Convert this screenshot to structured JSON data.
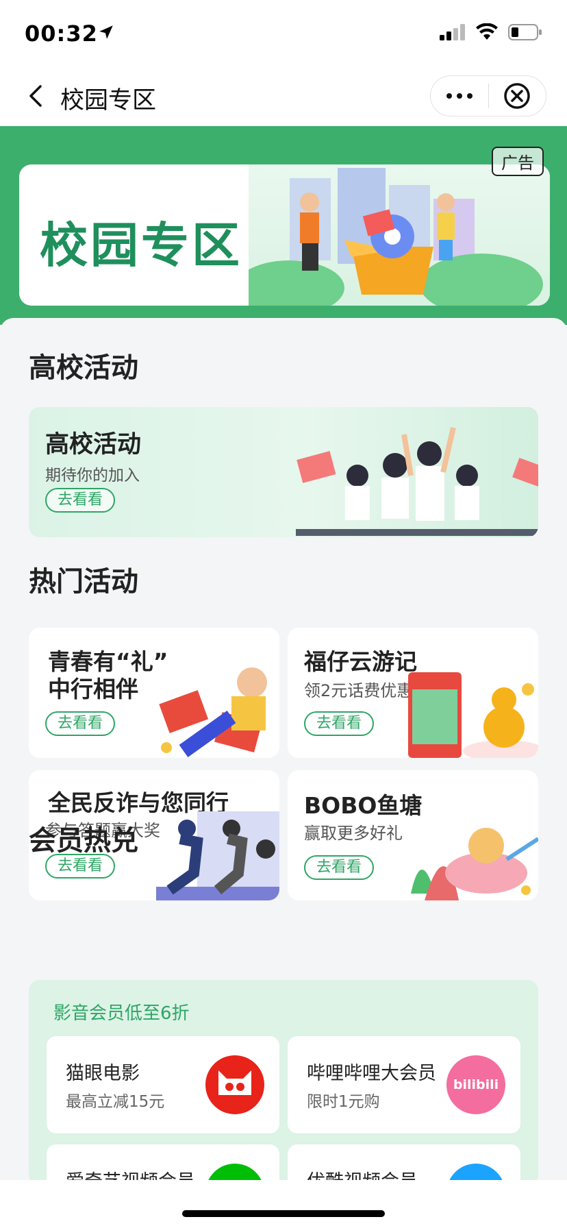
{
  "status_bar": {
    "time": "00:32"
  },
  "nav": {
    "title": "校园专区"
  },
  "hero": {
    "title": "校园专区",
    "ad_label": "广告"
  },
  "sections": {
    "campus": "高校活动",
    "hot": "热门活动",
    "member": "会员热兑"
  },
  "campus_card": {
    "title": "高校活动",
    "subtitle": "期待你的加入",
    "button": "去看看"
  },
  "hot_activities": [
    {
      "title_line1": "青春有“礼”",
      "title_line2": "中行相伴",
      "subtitle": "",
      "button": "去看看"
    },
    {
      "title_line1": "福仔云游记",
      "title_line2": "",
      "subtitle": "领2元话费优惠",
      "button": "去看看"
    },
    {
      "title_line1": "全民反诈与您同行",
      "title_line2": "",
      "subtitle": "参与答题赢大奖",
      "button": "去看看"
    },
    {
      "title_line1": "BOBO鱼塘",
      "title_line2": "",
      "subtitle": "赢取更多好礼",
      "button": "去看看"
    }
  ],
  "member": {
    "header": "影音会员低至6折",
    "items": [
      {
        "name": "猫眼电影",
        "sub": "最高立减15元",
        "logo": "maoyan-logo",
        "color": "#e8231a"
      },
      {
        "name": "哔哩哔哩大会员",
        "sub": "限时1元购",
        "logo": "bilibili-logo",
        "color": "#f36d9e",
        "logo_text": "bilibili"
      },
      {
        "name": "爱奇艺视频会员",
        "sub": "",
        "logo": "iqiyi-logo",
        "color": "#00be06"
      },
      {
        "name": "优酷视频会员",
        "sub": "",
        "logo": "youku-logo",
        "color": "#1aa3ff"
      }
    ]
  },
  "colors": {
    "brand_green": "#3daf6d",
    "accent_green": "#2ea565"
  }
}
